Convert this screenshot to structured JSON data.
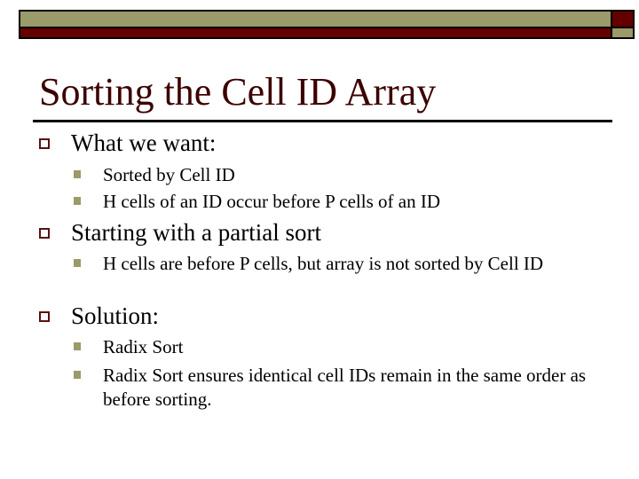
{
  "theme": {
    "olive": "#9a9a6a",
    "maroon": "#640000",
    "title_color": "#3c0000",
    "bullet_outline": "#5a1010",
    "bullet_fill": "#9a9a6a"
  },
  "slide": {
    "title": "Sorting the Cell ID Array",
    "bullets": [
      {
        "text": "What we want:",
        "icon": "hollow-square-bullet",
        "children": [
          {
            "text": "Sorted by Cell ID",
            "icon": "filled-square-bullet"
          },
          {
            "text": "H cells of an ID occur before P cells of an ID",
            "icon": "filled-square-bullet"
          }
        ]
      },
      {
        "text": "Starting with a partial sort",
        "icon": "hollow-square-bullet",
        "children": [
          {
            "text": "H cells are before P cells, but array is not sorted by Cell ID",
            "icon": "filled-square-bullet"
          }
        ]
      },
      {
        "text": "Solution:",
        "icon": "hollow-square-bullet",
        "children": [
          {
            "text": "Radix Sort",
            "icon": "filled-square-bullet"
          },
          {
            "text": "Radix Sort ensures identical cell IDs remain in the same order as before sorting.",
            "icon": "filled-square-bullet"
          }
        ]
      }
    ]
  }
}
